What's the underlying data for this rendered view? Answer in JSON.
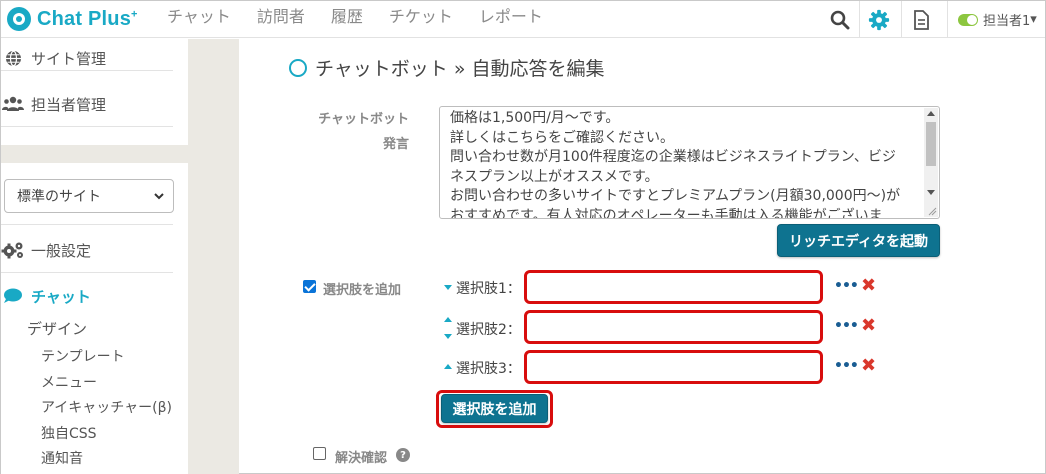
{
  "header": {
    "logo_text": "Chat Plus",
    "logo_sup": "+",
    "nav": [
      "チャット",
      "訪問者",
      "履歴",
      "チケット",
      "レポート"
    ],
    "user_label": "担当者1",
    "user_caret": "▾",
    "status_color": "#8cc63f",
    "icons": [
      "search-icon",
      "gear-icon",
      "document-icon"
    ]
  },
  "sidebar": {
    "top_items": [
      {
        "label": "サイト管理",
        "icon": "globe-icon"
      },
      {
        "label": "担当者管理",
        "icon": "users-icon"
      }
    ],
    "site_select": {
      "value": "標準のサイト"
    },
    "general_settings": {
      "label": "一般設定",
      "icon": "gears-icon"
    },
    "chat": {
      "label": "チャット",
      "icon": "speech-bubble-icon"
    },
    "design": "デザイン",
    "sub_items": [
      "テンプレート",
      "メニュー",
      "アイキャッチャー(β)",
      "独自CSS",
      "通知音"
    ]
  },
  "main": {
    "title": "チャットボット » 自動応答を編集",
    "bot_label_line1": "チャットボット",
    "bot_label_line2": "発言",
    "bot_message_lines": [
      "価格は1,500円/月～です。",
      "詳しくはこちらをご確認ください。",
      "問い合わせ数が月100件程度迄の企業様はビジネスライトプラン、ビジ",
      "ネスプラン以上がオススメです。",
      "お問い合わせの多いサイトですとプレミアムプラン(月額30,000円～)が",
      "おすすめです。有人対応のオペレーターも手動は入る機能がございま"
    ],
    "rich_editor_button": "リッチエディタを起動",
    "add_choices_label": "選択肢を追加",
    "add_choices_checked": true,
    "choices": [
      {
        "label": "選択肢1：",
        "value": ""
      },
      {
        "label": "選択肢2：",
        "value": ""
      },
      {
        "label": "選択肢3：",
        "value": ""
      }
    ],
    "add_choice_button": "選択肢を追加",
    "confirm_label": "解決確認",
    "confirm_checked": false,
    "more_glyph": "•••",
    "delete_glyph": "✖",
    "help_glyph": "?",
    "accent_color": "#19a9c5",
    "button_color": "#0e7390",
    "highlight_color": "#d80d0d"
  }
}
